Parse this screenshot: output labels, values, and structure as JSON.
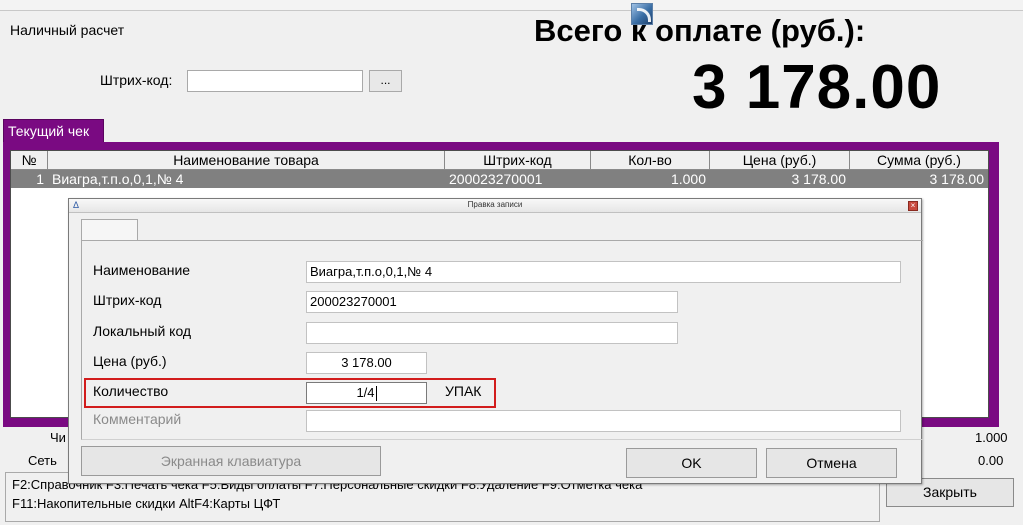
{
  "header": {
    "payment_mode": "Наличный расчет",
    "total_label": "Всего к оплате (руб.):",
    "total_amount": "3 178.00",
    "barcode_label": "Штрих-код:",
    "barcode_value": "",
    "browse_label": "..."
  },
  "receipt": {
    "tab_label": "Текущий чек",
    "columns": [
      "№",
      "Наименование товара",
      "Штрих-код",
      "Кол-во",
      "Цена (руб.)",
      "Сумма (руб.)"
    ],
    "rows": [
      {
        "num": "1",
        "name": "Виагра,т.п.о,0,1,№ 4",
        "barcode": "200023270001",
        "qty": "1.000",
        "price": "3 178.00",
        "sum": "3 178.00"
      }
    ]
  },
  "footer": {
    "label_check": "Чи",
    "label_net": "Сеть",
    "qty_total": "1.000",
    "discount_total": "0.00",
    "hotkeys_line1": "F2:Справочник  F3:Печать чека  F5:Виды оплаты  F7:Персональные скидки  F8:Удаление  F9:Отметка чека",
    "hotkeys_line2": "F11:Накопительные скидки  AltF4:Карты ЦФТ",
    "close_label": "Закрыть"
  },
  "dialog": {
    "title": "Правка записи",
    "close_glyph": "×",
    "app_icon_glyph": "Δ",
    "fields": {
      "name_label": "Наименование",
      "name_value": "Виагра,т.п.о,0,1,№ 4",
      "barcode_label": "Штрих-код",
      "barcode_value": "200023270001",
      "local_code_label": "Локальный код",
      "local_code_value": "",
      "price_label": "Цена (руб.)",
      "price_value": "3 178.00",
      "qty_label": "Количество",
      "qty_value": "1/4",
      "qty_unit": "УПАК",
      "comment_label": "Комментарий",
      "comment_value": ""
    },
    "keyboard_label": "Экранная клавиатура",
    "ok_label": "OK",
    "cancel_label": "Отмена"
  },
  "colors": {
    "receipt_frame": "#7a0a82",
    "selected_row": "#808080",
    "highlight_box": "#d21c1c"
  }
}
